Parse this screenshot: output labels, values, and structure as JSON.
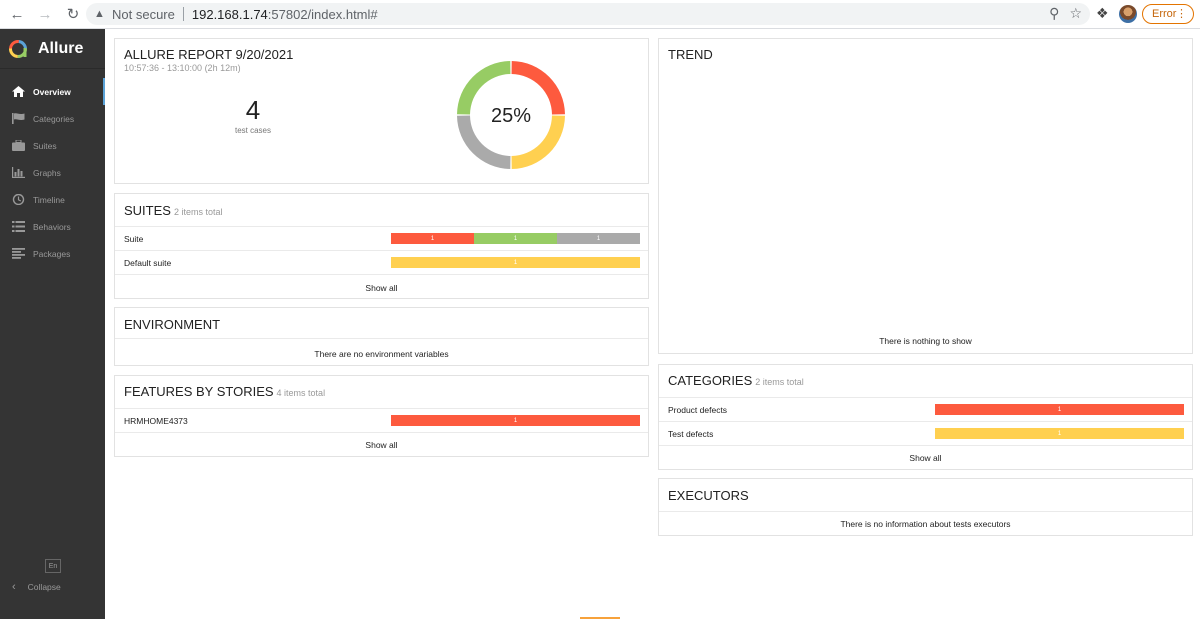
{
  "browser": {
    "security_label": "Not secure",
    "url_host": "192.168.1.74",
    "url_rest": ":57802/index.html#",
    "error_label": "Error"
  },
  "sidebar": {
    "brand": "Allure",
    "items": [
      {
        "label": "Overview",
        "icon": "home-icon",
        "active": true
      },
      {
        "label": "Categories",
        "icon": "flag-icon",
        "active": false
      },
      {
        "label": "Suites",
        "icon": "briefcase-icon",
        "active": false
      },
      {
        "label": "Graphs",
        "icon": "bar-chart-icon",
        "active": false
      },
      {
        "label": "Timeline",
        "icon": "clock-icon",
        "active": false
      },
      {
        "label": "Behaviors",
        "icon": "list-icon",
        "active": false
      },
      {
        "label": "Packages",
        "icon": "align-left-icon",
        "active": false
      }
    ],
    "lang": "En",
    "collapse": "Collapse"
  },
  "summary": {
    "title": "ALLURE REPORT 9/20/2021",
    "time": "10:57:36 - 13:10:00 (2h 12m)",
    "count": "4",
    "count_caption": "test cases",
    "percent": "25%",
    "donut": [
      {
        "status": "failed",
        "value": 1,
        "color": "#fd5a3e"
      },
      {
        "status": "broken",
        "value": 1,
        "color": "#ffd050"
      },
      {
        "status": "skipped",
        "value": 1,
        "color": "#aaaaaa"
      },
      {
        "status": "passed",
        "value": 1,
        "color": "#97cc64"
      }
    ]
  },
  "suites": {
    "title": "SUITES",
    "subtitle": "2 items total",
    "rows": [
      {
        "name": "Suite",
        "segments": [
          {
            "value": "1",
            "color": "#fd5a3e"
          },
          {
            "value": "1",
            "color": "#97cc64"
          },
          {
            "value": "1",
            "color": "#aaaaaa"
          }
        ]
      },
      {
        "name": "Default suite",
        "segments": [
          {
            "value": "1",
            "color": "#ffd050"
          }
        ]
      }
    ],
    "show_all": "Show all"
  },
  "environment": {
    "title": "ENVIRONMENT",
    "message": "There are no environment variables"
  },
  "features": {
    "title": "FEATURES BY STORIES",
    "subtitle": "4 items total",
    "rows": [
      {
        "name": "HRMHOME4373",
        "segments": [
          {
            "value": "1",
            "color": "#fd5a3e"
          }
        ]
      }
    ],
    "show_all": "Show all"
  },
  "trend": {
    "title": "TREND",
    "message": "There is nothing to show"
  },
  "categories": {
    "title": "CATEGORIES",
    "subtitle": "2 items total",
    "rows": [
      {
        "name": "Product defects",
        "segments": [
          {
            "value": "1",
            "color": "#fd5a3e"
          }
        ]
      },
      {
        "name": "Test defects",
        "segments": [
          {
            "value": "1",
            "color": "#ffd050"
          }
        ]
      }
    ],
    "show_all": "Show all"
  },
  "executors": {
    "title": "EXECUTORS",
    "message": "There is no information about tests executors"
  }
}
